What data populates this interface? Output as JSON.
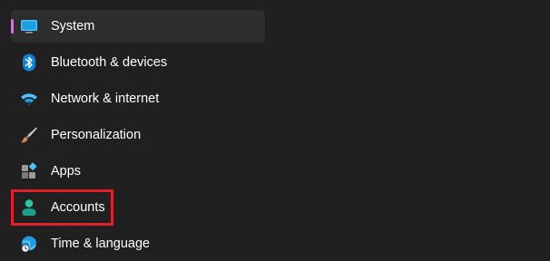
{
  "nav": {
    "items": [
      {
        "label": "System",
        "icon": "system-display-icon",
        "selected": true
      },
      {
        "label": "Bluetooth & devices",
        "icon": "bluetooth-icon",
        "selected": false
      },
      {
        "label": "Network & internet",
        "icon": "wifi-icon",
        "selected": false
      },
      {
        "label": "Personalization",
        "icon": "paintbrush-icon",
        "selected": false
      },
      {
        "label": "Apps",
        "icon": "apps-icon",
        "selected": false
      },
      {
        "label": "Accounts",
        "icon": "person-icon",
        "selected": false
      },
      {
        "label": "Time & language",
        "icon": "globe-clock-icon",
        "selected": false
      }
    ]
  },
  "colors": {
    "background": "#202020",
    "selected_background": "#2d2d2d",
    "selection_indicator": "#c77dcc",
    "highlight_box": "#e0212b",
    "text": "#ffffff"
  }
}
